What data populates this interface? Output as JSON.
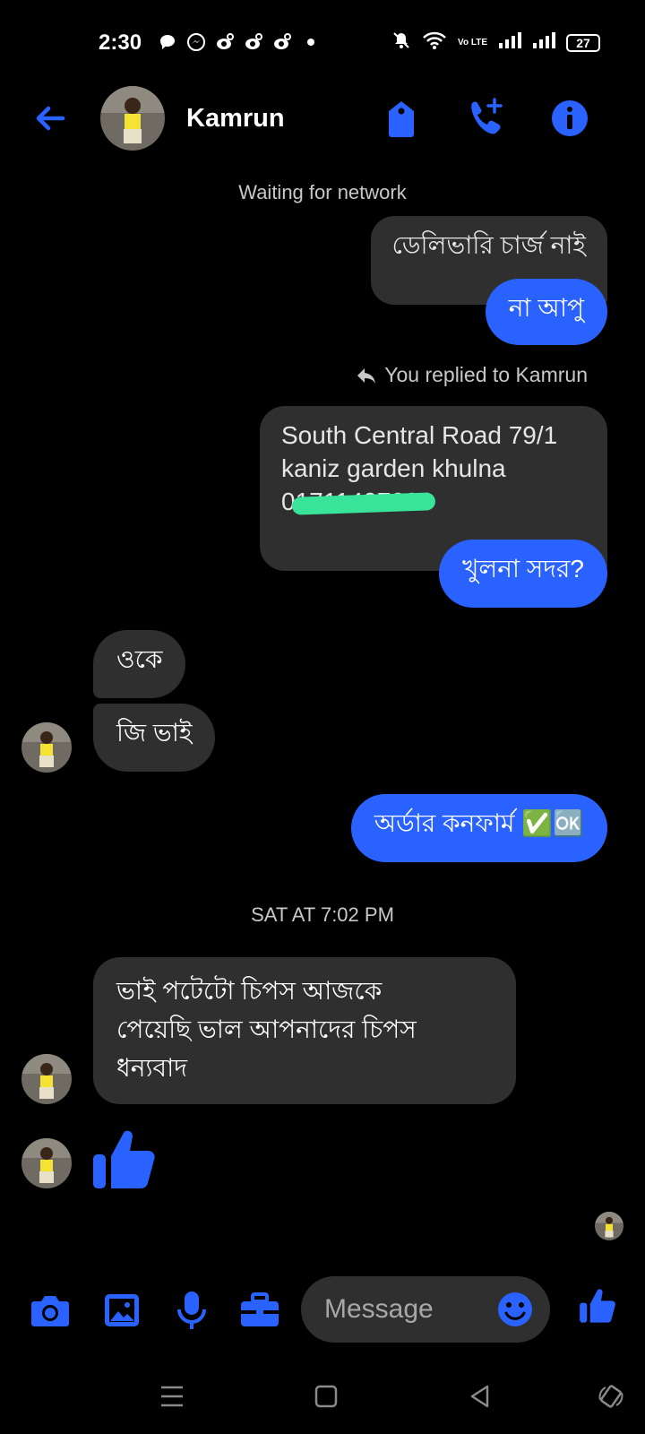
{
  "status_bar": {
    "time": "2:30",
    "battery": "27",
    "network": "Vo LTE"
  },
  "header": {
    "contact_name": "Kamrun",
    "icons": [
      "back-arrow-icon",
      "tag-icon",
      "add-call-icon",
      "info-icon"
    ]
  },
  "conversation": {
    "network_status": "Waiting for network",
    "messages": [
      {
        "from": "me",
        "style": "gray",
        "text": "ডেলিভারি চার্জ  নাই"
      },
      {
        "from": "me",
        "style": "blue",
        "text": "না আপু"
      },
      {
        "from": "me",
        "style": "reply_header",
        "text": "You replied to Kamrun"
      },
      {
        "from": "me",
        "style": "gray",
        "lines": [
          "South Central Road 79/1",
          "kaniz garden khulna",
          "01711407006"
        ]
      },
      {
        "from": "me",
        "style": "blue",
        "text": "খুলনা সদর?"
      },
      {
        "from": "them",
        "text": "ওকে"
      },
      {
        "from": "them",
        "text": "জি ভাই"
      },
      {
        "from": "me",
        "style": "blue",
        "text": "অর্ডার কনফার্ম ✅🆗"
      },
      {
        "from": "them",
        "lines": [
          "ভাই  পটেটো চিপস আজকে",
          "পেয়েছি ভাল আপনাদের চিপস",
          "ধন্যবাদ"
        ]
      },
      {
        "from": "them",
        "type": "like"
      }
    ],
    "date_separator": "SAT AT 7:02 PM"
  },
  "composer": {
    "placeholder": "Message",
    "icons": [
      "camera-icon",
      "gallery-icon",
      "microphone-icon",
      "briefcase-icon",
      "emoji-icon",
      "thumbs-up-icon"
    ]
  },
  "colors": {
    "accent": "#2a62ff",
    "bubble_gray": "#2f2f2f",
    "background": "#000000",
    "redaction": "#38e39a"
  }
}
